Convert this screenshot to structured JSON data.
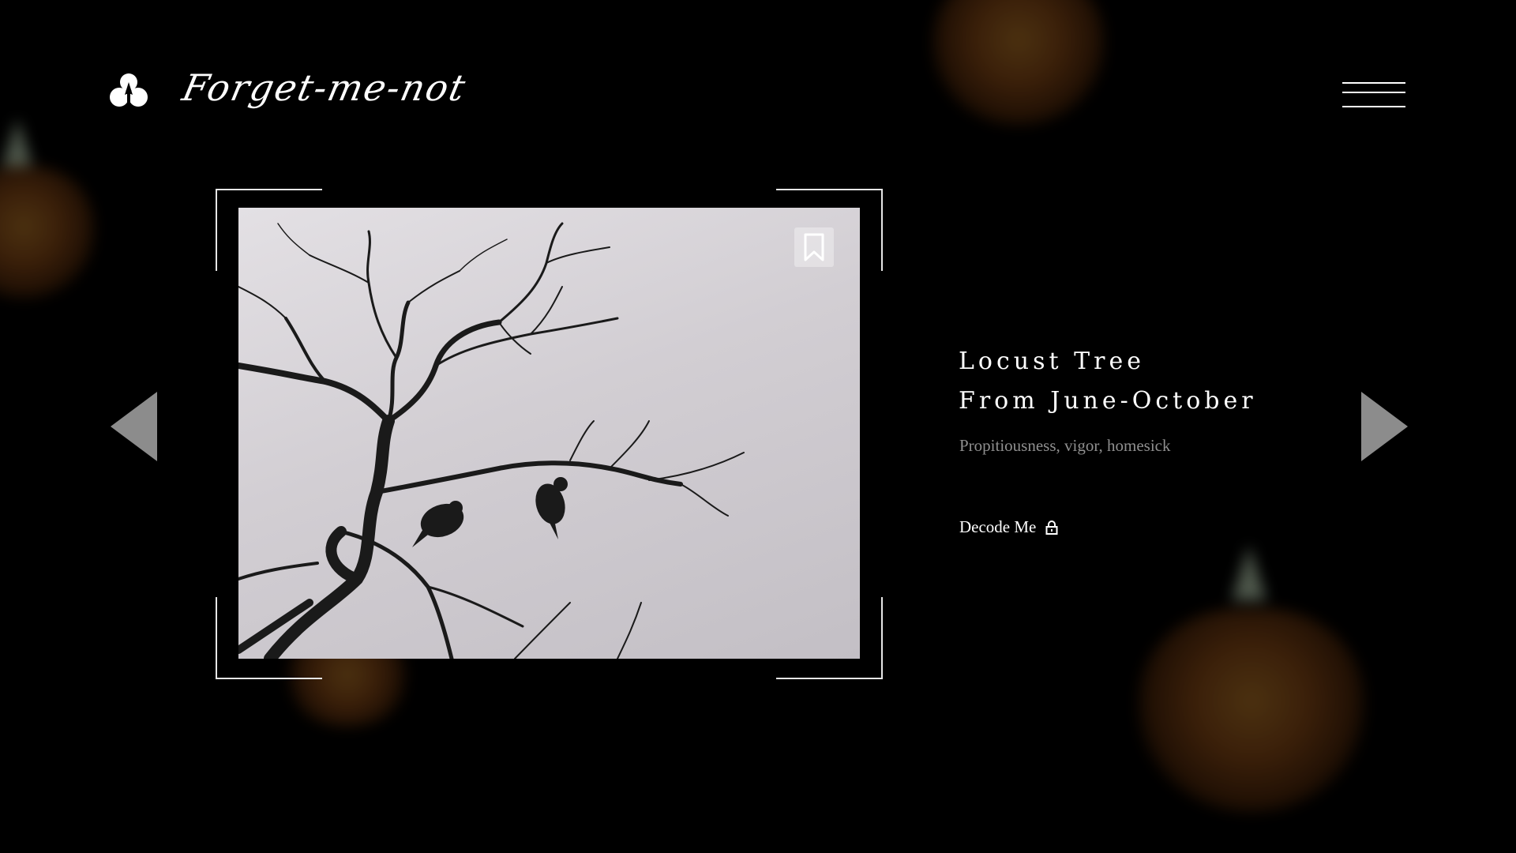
{
  "header": {
    "brand": "Forget-me-not",
    "logo_icon": "three-dot-flower-icon",
    "menu_icon": "hamburger-menu-icon"
  },
  "slide": {
    "title_line1": "Locust Tree",
    "title_line2": "From June-October",
    "subtitle": "Propitiousness, vigor, homesick",
    "action_label": "Decode Me",
    "action_icon": "lock-icon",
    "bookmark_icon": "bookmark-icon",
    "prev_icon": "triangle-left-icon",
    "next_icon": "triangle-right-icon"
  },
  "colors": {
    "background": "#000000",
    "text_primary": "#ffffff",
    "text_muted": "#8f8f8f",
    "arrow": "#8c8c8c"
  }
}
